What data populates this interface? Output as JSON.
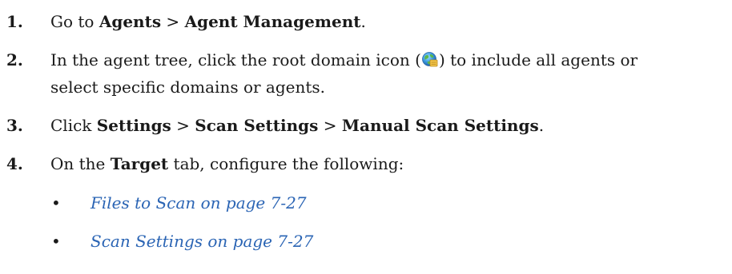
{
  "steps": [
    {
      "number": "1.",
      "parts": {
        "a": "Go to ",
        "b": "Agents",
        "c": " > ",
        "d": "Agent Management",
        "e": "."
      }
    },
    {
      "number": "2.",
      "line1_before": "In the agent tree, click the root domain icon (",
      "icon": "root-domain-globe-icon",
      "line1_after": ") to include all agents or",
      "line2": "select specific domains or agents."
    },
    {
      "number": "3.",
      "parts": {
        "a": "Click ",
        "b": "Settings",
        "c": " > ",
        "d": "Scan Settings",
        "e": " > ",
        "f": "Manual Scan Settings",
        "g": "."
      }
    },
    {
      "number": "4.",
      "parts": {
        "a": "On the ",
        "b": "Target",
        "c": " tab, configure the following:"
      }
    }
  ],
  "links": [
    {
      "bullet": "•",
      "text": "Files to Scan on page 7-27"
    },
    {
      "bullet": "•",
      "text": "Scan Settings on page 7-27"
    }
  ],
  "colors": {
    "link": "#2a64b4",
    "text": "#1a1a1a"
  }
}
